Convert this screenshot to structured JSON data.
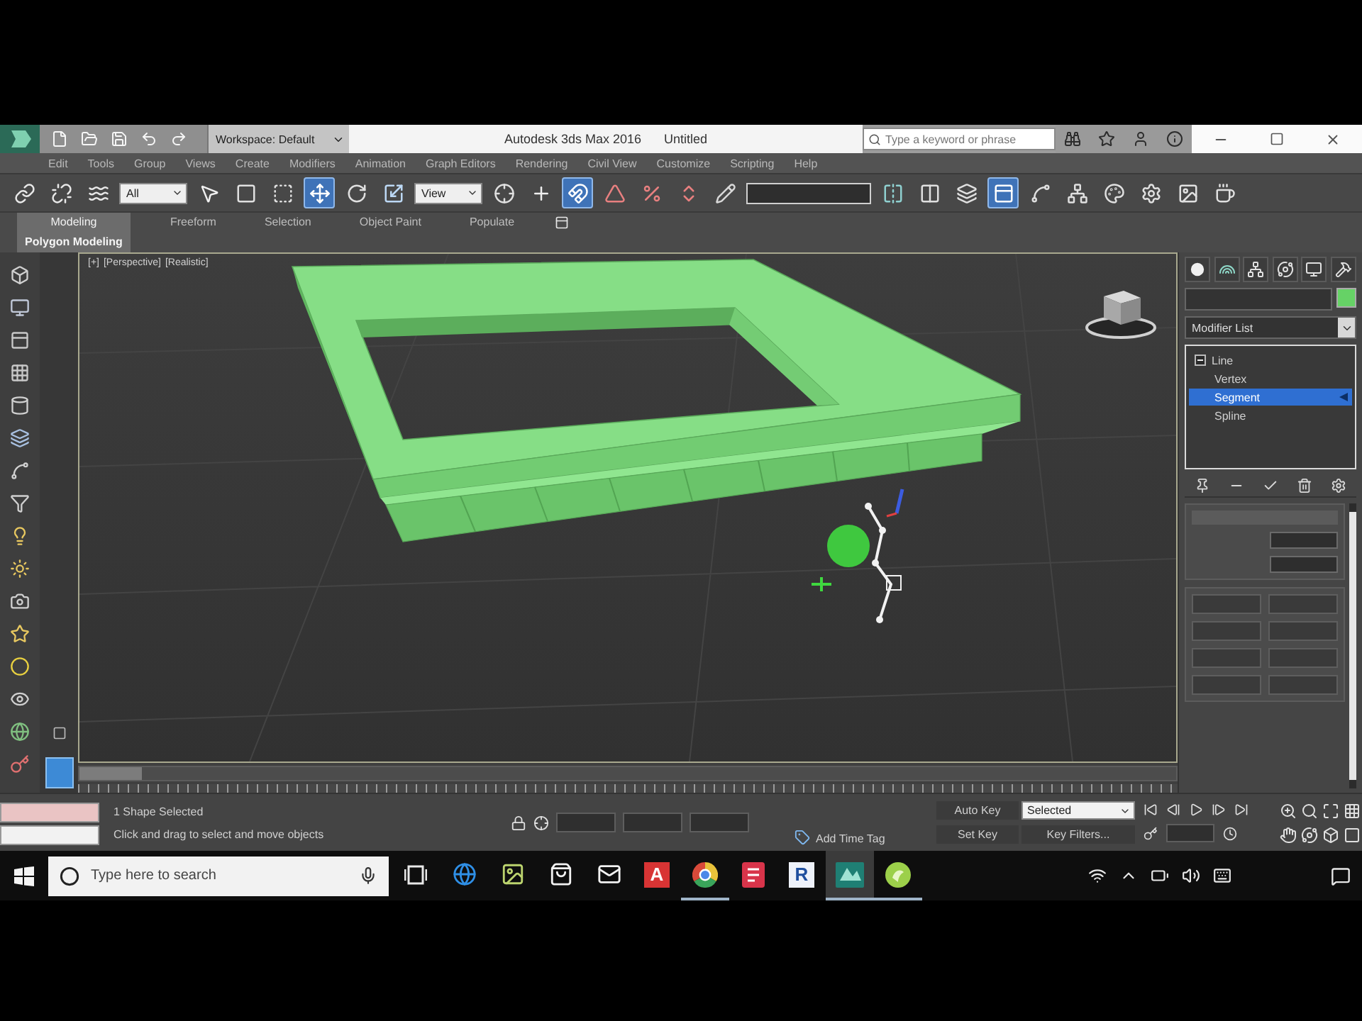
{
  "title_bar": {
    "workspace": "Workspace: Default",
    "title": "Autodesk 3ds Max 2016",
    "document": "Untitled",
    "search_field": {
      "placeholder": "Type a keyword or phrase"
    }
  },
  "menu_bar": {
    "items": [
      "Edit",
      "Tools",
      "Group",
      "Views",
      "Create",
      "Modifiers",
      "Animation",
      "Graph Editors",
      "Rendering",
      "Civil View",
      "Customize",
      "Scripting",
      "Help"
    ]
  },
  "main_toolbar": {
    "tools": [
      {
        "kind": "link",
        "selected": false
      },
      {
        "kind": "unlink",
        "selected": false
      },
      {
        "kind": "bind",
        "selected": false
      },
      {
        "kind": "dropdown",
        "value": "All"
      },
      {
        "kind": "select",
        "selected": false
      },
      {
        "kind": "region",
        "selected": false
      },
      {
        "kind": "crossing",
        "selected": false
      },
      {
        "kind": "move",
        "selected": true
      },
      {
        "kind": "rotate",
        "selected": false
      },
      {
        "kind": "scale",
        "selected": false
      },
      {
        "kind": "dropdown",
        "value": "View"
      },
      {
        "kind": "pivot",
        "selected": false
      },
      {
        "kind": "manipulate",
        "selected": false
      },
      {
        "kind": "snap",
        "selected": true
      },
      {
        "kind": "angle-snap",
        "selected": false
      },
      {
        "kind": "percent-snap",
        "selected": false
      },
      {
        "kind": "spinner-snap",
        "selected": false
      },
      {
        "kind": "edit-named",
        "selected": false
      },
      {
        "kind": "field"
      },
      {
        "kind": "mirror",
        "selected": false
      },
      {
        "kind": "align",
        "selected": false
      },
      {
        "kind": "layers",
        "selected": false
      },
      {
        "kind": "ribbon",
        "selected": true
      },
      {
        "kind": "curves",
        "selected": false
      },
      {
        "kind": "schematic",
        "selected": false
      },
      {
        "kind": "material",
        "selected": false
      },
      {
        "kind": "render-setup",
        "selected": false
      },
      {
        "kind": "frame",
        "selected": false
      },
      {
        "kind": "render",
        "selected": false
      }
    ]
  },
  "ribbon": {
    "tabs": [
      {
        "label": "Modeling",
        "selected": true
      },
      {
        "label": "Freeform",
        "selected": false
      },
      {
        "label": "Selection",
        "selected": false
      },
      {
        "label": "Object Paint",
        "selected": false
      },
      {
        "label": "Populate",
        "selected": false
      }
    ],
    "panels": [
      "Polygon Modeling"
    ]
  },
  "viewport": {
    "labels": [
      "[+]",
      "[Perspective]",
      "[Realistic]"
    ]
  },
  "timeline": {
    "level": 0
  },
  "command_panel": {
    "modifier_list": "Modifier List",
    "stack": [
      {
        "label": "Line",
        "expanded": true,
        "selected": false,
        "children": [
          {
            "label": "Vertex",
            "selected": false
          },
          {
            "label": "Segment",
            "selected": true
          },
          {
            "label": "Spline",
            "selected": false
          }
        ]
      }
    ]
  },
  "status_bar": {
    "selection": "1 Shape Selected",
    "prompt": "Click and drag to select and move objects",
    "time_tag": "Add Time Tag",
    "auto_key": "Auto Key",
    "key_mode": "Selected",
    "set_key": "Set Key",
    "key_filters": "Key Filters..."
  },
  "taskbar": {
    "search": {
      "placeholder": "Type here to search"
    },
    "apps": [
      {
        "kind": "task-view",
        "running": false,
        "selected": false
      },
      {
        "kind": "edge",
        "running": false,
        "selected": false
      },
      {
        "kind": "photos",
        "running": false,
        "selected": false
      },
      {
        "kind": "store",
        "running": false,
        "selected": false
      },
      {
        "kind": "mail",
        "running": false,
        "selected": false
      },
      {
        "kind": "cad",
        "label": "A",
        "running": false,
        "selected": false
      },
      {
        "kind": "chrome",
        "running": true,
        "selected": false
      },
      {
        "kind": "red-app",
        "running": false,
        "selected": false
      },
      {
        "kind": "bim",
        "label": "R",
        "running": false,
        "selected": false
      },
      {
        "kind": "max",
        "running": true,
        "selected": true
      },
      {
        "kind": "green-app",
        "running": true,
        "selected": false
      }
    ]
  }
}
